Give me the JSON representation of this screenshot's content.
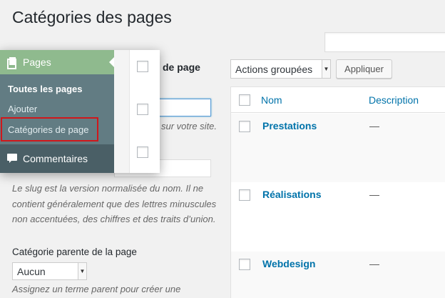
{
  "page": {
    "title": "Catégories des pages"
  },
  "form": {
    "name_label_fragment": "de page",
    "name_help_fragment": "sur votre site.",
    "slug_help": "Le slug est la version normalisée du nom. Il ne contient généralement que des lettres minuscules non accentuées, des chiffres et des traits d’union.",
    "parent_label": "Catégorie parente de la page",
    "parent_select_value": "Aucun",
    "parent_help": "Assignez un terme parent pour créer une"
  },
  "table": {
    "bulk_actions_value": "Actions groupées",
    "apply_label": "Appliquer",
    "columns": {
      "name": "Nom",
      "description": "Description"
    },
    "rows": [
      {
        "name": "Prestations",
        "description": "—"
      },
      {
        "name": "Réalisations",
        "description": "—"
      },
      {
        "name": "Webdesign",
        "description": "—"
      }
    ]
  },
  "admin_menu": {
    "pages_label": "Pages",
    "submenu": [
      {
        "label": "Toutes les pages",
        "current": true
      },
      {
        "label": "Ajouter",
        "current": false
      },
      {
        "label": "Catégories de page",
        "current": false,
        "highlighted": true
      }
    ],
    "comments_label": "Commentaires",
    "active_color": "#8fba8e",
    "highlight_color": "#d0171b"
  },
  "colors": {
    "link": "#0073aa",
    "background": "#f1f1f1"
  },
  "icons": {
    "pages": "pages-icon",
    "comments": "comments-icon",
    "dropdown": "chevron-down-icon"
  }
}
